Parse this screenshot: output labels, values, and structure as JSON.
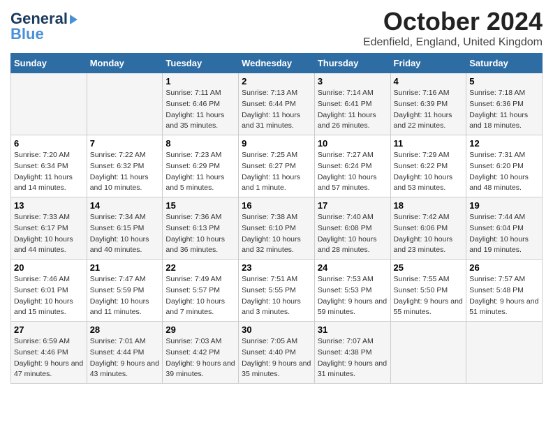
{
  "header": {
    "logo_general": "General",
    "logo_blue": "Blue",
    "month_title": "October 2024",
    "location": "Edenfield, England, United Kingdom"
  },
  "weekdays": [
    "Sunday",
    "Monday",
    "Tuesday",
    "Wednesday",
    "Thursday",
    "Friday",
    "Saturday"
  ],
  "weeks": [
    [
      {
        "day": "",
        "sunrise": "",
        "sunset": "",
        "daylight": ""
      },
      {
        "day": "",
        "sunrise": "",
        "sunset": "",
        "daylight": ""
      },
      {
        "day": "1",
        "sunrise": "Sunrise: 7:11 AM",
        "sunset": "Sunset: 6:46 PM",
        "daylight": "Daylight: 11 hours and 35 minutes."
      },
      {
        "day": "2",
        "sunrise": "Sunrise: 7:13 AM",
        "sunset": "Sunset: 6:44 PM",
        "daylight": "Daylight: 11 hours and 31 minutes."
      },
      {
        "day": "3",
        "sunrise": "Sunrise: 7:14 AM",
        "sunset": "Sunset: 6:41 PM",
        "daylight": "Daylight: 11 hours and 26 minutes."
      },
      {
        "day": "4",
        "sunrise": "Sunrise: 7:16 AM",
        "sunset": "Sunset: 6:39 PM",
        "daylight": "Daylight: 11 hours and 22 minutes."
      },
      {
        "day": "5",
        "sunrise": "Sunrise: 7:18 AM",
        "sunset": "Sunset: 6:36 PM",
        "daylight": "Daylight: 11 hours and 18 minutes."
      }
    ],
    [
      {
        "day": "6",
        "sunrise": "Sunrise: 7:20 AM",
        "sunset": "Sunset: 6:34 PM",
        "daylight": "Daylight: 11 hours and 14 minutes."
      },
      {
        "day": "7",
        "sunrise": "Sunrise: 7:22 AM",
        "sunset": "Sunset: 6:32 PM",
        "daylight": "Daylight: 11 hours and 10 minutes."
      },
      {
        "day": "8",
        "sunrise": "Sunrise: 7:23 AM",
        "sunset": "Sunset: 6:29 PM",
        "daylight": "Daylight: 11 hours and 5 minutes."
      },
      {
        "day": "9",
        "sunrise": "Sunrise: 7:25 AM",
        "sunset": "Sunset: 6:27 PM",
        "daylight": "Daylight: 11 hours and 1 minute."
      },
      {
        "day": "10",
        "sunrise": "Sunrise: 7:27 AM",
        "sunset": "Sunset: 6:24 PM",
        "daylight": "Daylight: 10 hours and 57 minutes."
      },
      {
        "day": "11",
        "sunrise": "Sunrise: 7:29 AM",
        "sunset": "Sunset: 6:22 PM",
        "daylight": "Daylight: 10 hours and 53 minutes."
      },
      {
        "day": "12",
        "sunrise": "Sunrise: 7:31 AM",
        "sunset": "Sunset: 6:20 PM",
        "daylight": "Daylight: 10 hours and 48 minutes."
      }
    ],
    [
      {
        "day": "13",
        "sunrise": "Sunrise: 7:33 AM",
        "sunset": "Sunset: 6:17 PM",
        "daylight": "Daylight: 10 hours and 44 minutes."
      },
      {
        "day": "14",
        "sunrise": "Sunrise: 7:34 AM",
        "sunset": "Sunset: 6:15 PM",
        "daylight": "Daylight: 10 hours and 40 minutes."
      },
      {
        "day": "15",
        "sunrise": "Sunrise: 7:36 AM",
        "sunset": "Sunset: 6:13 PM",
        "daylight": "Daylight: 10 hours and 36 minutes."
      },
      {
        "day": "16",
        "sunrise": "Sunrise: 7:38 AM",
        "sunset": "Sunset: 6:10 PM",
        "daylight": "Daylight: 10 hours and 32 minutes."
      },
      {
        "day": "17",
        "sunrise": "Sunrise: 7:40 AM",
        "sunset": "Sunset: 6:08 PM",
        "daylight": "Daylight: 10 hours and 28 minutes."
      },
      {
        "day": "18",
        "sunrise": "Sunrise: 7:42 AM",
        "sunset": "Sunset: 6:06 PM",
        "daylight": "Daylight: 10 hours and 23 minutes."
      },
      {
        "day": "19",
        "sunrise": "Sunrise: 7:44 AM",
        "sunset": "Sunset: 6:04 PM",
        "daylight": "Daylight: 10 hours and 19 minutes."
      }
    ],
    [
      {
        "day": "20",
        "sunrise": "Sunrise: 7:46 AM",
        "sunset": "Sunset: 6:01 PM",
        "daylight": "Daylight: 10 hours and 15 minutes."
      },
      {
        "day": "21",
        "sunrise": "Sunrise: 7:47 AM",
        "sunset": "Sunset: 5:59 PM",
        "daylight": "Daylight: 10 hours and 11 minutes."
      },
      {
        "day": "22",
        "sunrise": "Sunrise: 7:49 AM",
        "sunset": "Sunset: 5:57 PM",
        "daylight": "Daylight: 10 hours and 7 minutes."
      },
      {
        "day": "23",
        "sunrise": "Sunrise: 7:51 AM",
        "sunset": "Sunset: 5:55 PM",
        "daylight": "Daylight: 10 hours and 3 minutes."
      },
      {
        "day": "24",
        "sunrise": "Sunrise: 7:53 AM",
        "sunset": "Sunset: 5:53 PM",
        "daylight": "Daylight: 9 hours and 59 minutes."
      },
      {
        "day": "25",
        "sunrise": "Sunrise: 7:55 AM",
        "sunset": "Sunset: 5:50 PM",
        "daylight": "Daylight: 9 hours and 55 minutes."
      },
      {
        "day": "26",
        "sunrise": "Sunrise: 7:57 AM",
        "sunset": "Sunset: 5:48 PM",
        "daylight": "Daylight: 9 hours and 51 minutes."
      }
    ],
    [
      {
        "day": "27",
        "sunrise": "Sunrise: 6:59 AM",
        "sunset": "Sunset: 4:46 PM",
        "daylight": "Daylight: 9 hours and 47 minutes."
      },
      {
        "day": "28",
        "sunrise": "Sunrise: 7:01 AM",
        "sunset": "Sunset: 4:44 PM",
        "daylight": "Daylight: 9 hours and 43 minutes."
      },
      {
        "day": "29",
        "sunrise": "Sunrise: 7:03 AM",
        "sunset": "Sunset: 4:42 PM",
        "daylight": "Daylight: 9 hours and 39 minutes."
      },
      {
        "day": "30",
        "sunrise": "Sunrise: 7:05 AM",
        "sunset": "Sunset: 4:40 PM",
        "daylight": "Daylight: 9 hours and 35 minutes."
      },
      {
        "day": "31",
        "sunrise": "Sunrise: 7:07 AM",
        "sunset": "Sunset: 4:38 PM",
        "daylight": "Daylight: 9 hours and 31 minutes."
      },
      {
        "day": "",
        "sunrise": "",
        "sunset": "",
        "daylight": ""
      },
      {
        "day": "",
        "sunrise": "",
        "sunset": "",
        "daylight": ""
      }
    ]
  ]
}
